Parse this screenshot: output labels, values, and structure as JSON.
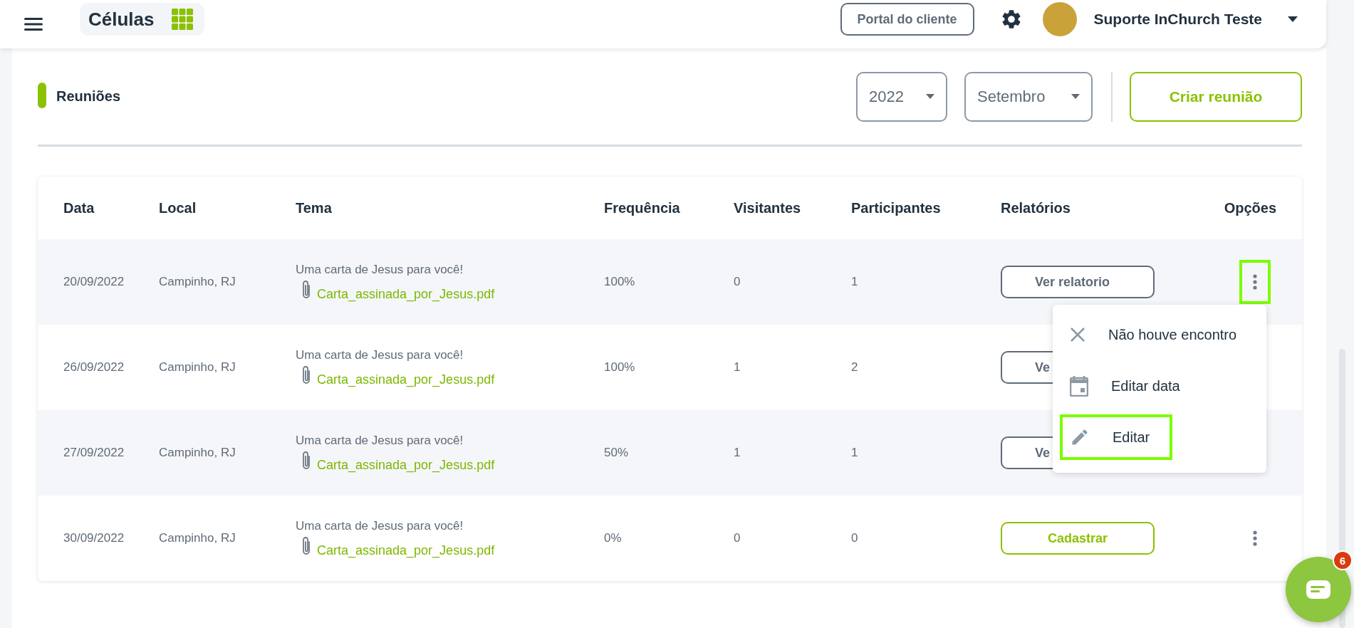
{
  "topbar": {
    "module_title": "Células",
    "portal_button": "Portal do cliente",
    "user_name": "Suporte InChurch Teste"
  },
  "section": {
    "title": "Reuniões",
    "year": "2022",
    "month": "Setembro",
    "create_button": "Criar reunião"
  },
  "table": {
    "columns": [
      "Data",
      "Local",
      "Tema",
      "Frequência",
      "Visitantes",
      "Participantes",
      "Relatórios",
      "Opções"
    ],
    "rows": [
      {
        "date": "20/09/2022",
        "place": "Campinho, RJ",
        "theme": "Uma carta de Jesus para você!",
        "attachment": "Carta_assinada_por_Jesus.pdf",
        "frequency": "100%",
        "visitors": "0",
        "participants": "1",
        "report": {
          "kind": "view",
          "label": "Ver relatorio"
        },
        "options_highlighted": true
      },
      {
        "date": "26/09/2022",
        "place": "Campinho, RJ",
        "theme": "Uma carta de Jesus para você!",
        "attachment": "Carta_assinada_por_Jesus.pdf",
        "frequency": "100%",
        "visitors": "1",
        "participants": "2",
        "report": {
          "kind": "view",
          "label": "Ve"
        },
        "options_highlighted": false
      },
      {
        "date": "27/09/2022",
        "place": "Campinho, RJ",
        "theme": "Uma carta de Jesus para você!",
        "attachment": "Carta_assinada_por_Jesus.pdf",
        "frequency": "50%",
        "visitors": "1",
        "participants": "1",
        "report": {
          "kind": "view",
          "label": "Ve"
        },
        "options_highlighted": false
      },
      {
        "date": "30/09/2022",
        "place": "Campinho, RJ",
        "theme": "Uma carta de Jesus para você!",
        "attachment": "Carta_assinada_por_Jesus.pdf",
        "frequency": "0%",
        "visitors": "0",
        "participants": "0",
        "report": {
          "kind": "register",
          "label": "Cadastrar"
        },
        "options_highlighted": false
      }
    ]
  },
  "options_menu": {
    "items": [
      {
        "kind": "cancel",
        "label": "Não houve encontro",
        "highlighted": false
      },
      {
        "kind": "date",
        "label": "Editar data",
        "highlighted": false
      },
      {
        "kind": "edit",
        "label": "Editar",
        "highlighted": true
      }
    ]
  },
  "chat": {
    "badge": "6"
  }
}
